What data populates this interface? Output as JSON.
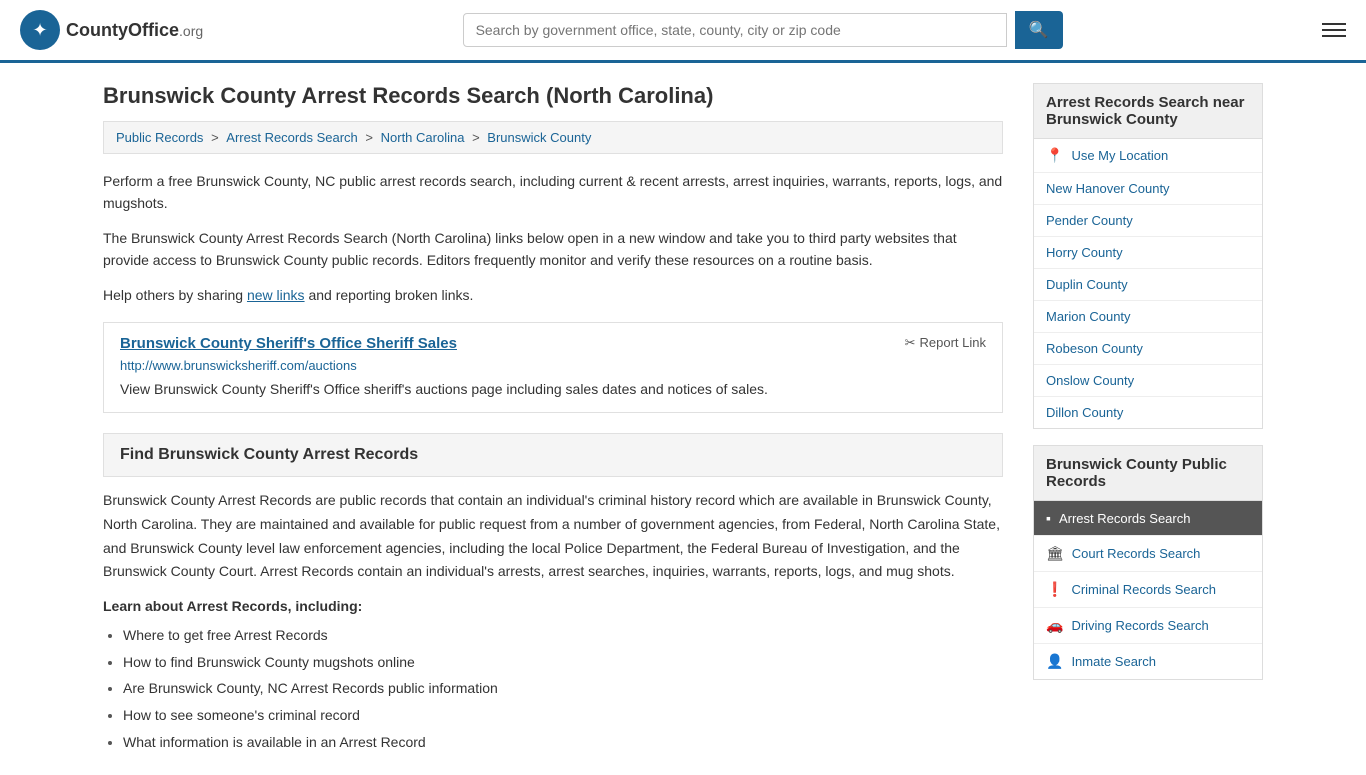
{
  "header": {
    "logo_symbol": "✦",
    "logo_name": "CountyOffice",
    "logo_suffix": ".org",
    "search_placeholder": "Search by government office, state, county, city or zip code",
    "search_value": ""
  },
  "page": {
    "title": "Brunswick County Arrest Records Search (North Carolina)"
  },
  "breadcrumb": {
    "items": [
      {
        "label": "Public Records",
        "href": "#"
      },
      {
        "label": "Arrest Records Search",
        "href": "#"
      },
      {
        "label": "North Carolina",
        "href": "#"
      },
      {
        "label": "Brunswick County",
        "href": "#"
      }
    ]
  },
  "description": {
    "para1": "Perform a free Brunswick County, NC public arrest records search, including current & recent arrests, arrest inquiries, warrants, reports, logs, and mugshots.",
    "para2": "The Brunswick County Arrest Records Search (North Carolina) links below open in a new window and take you to third party websites that provide access to Brunswick County public records. Editors frequently monitor and verify these resources on a routine basis.",
    "para3_prefix": "Help others by sharing ",
    "para3_link": "new links",
    "para3_suffix": " and reporting broken links."
  },
  "link_entry": {
    "title": "Brunswick County Sheriff's Office Sheriff Sales",
    "url": "http://www.brunswicksheriff.com/auctions",
    "report_label": "Report Link",
    "description": "View Brunswick County Sheriff's Office sheriff's auctions page including sales dates and notices of sales."
  },
  "find_section": {
    "title": "Find Brunswick County Arrest Records",
    "body": "Brunswick County Arrest Records are public records that contain an individual's criminal history record which are available in Brunswick County, North Carolina. They are maintained and available for public request from a number of government agencies, from Federal, North Carolina State, and Brunswick County level law enforcement agencies, including the local Police Department, the Federal Bureau of Investigation, and the Brunswick County Court. Arrest Records contain an individual's arrests, arrest searches, inquiries, warrants, reports, logs, and mug shots.",
    "learn_title": "Learn about Arrest Records, including:",
    "learn_items": [
      "Where to get free Arrest Records",
      "How to find Brunswick County mugshots online",
      "Are Brunswick County, NC Arrest Records public information",
      "How to see someone's criminal record",
      "What information is available in an Arrest Record"
    ]
  },
  "sidebar": {
    "nearby_title": "Arrest Records Search near Brunswick County",
    "use_location_label": "Use My Location",
    "nearby_links": [
      {
        "label": "New Hanover County",
        "href": "#"
      },
      {
        "label": "Pender County",
        "href": "#"
      },
      {
        "label": "Horry County",
        "href": "#"
      },
      {
        "label": "Duplin County",
        "href": "#"
      },
      {
        "label": "Marion County",
        "href": "#"
      },
      {
        "label": "Robeson County",
        "href": "#"
      },
      {
        "label": "Onslow County",
        "href": "#"
      },
      {
        "label": "Dillon County",
        "href": "#"
      }
    ],
    "public_records_title": "Brunswick County Public Records",
    "public_records_links": [
      {
        "label": "Arrest Records Search",
        "icon": "▪",
        "active": true
      },
      {
        "label": "Court Records Search",
        "icon": "🏛",
        "active": false
      },
      {
        "label": "Criminal Records Search",
        "icon": "❗",
        "active": false
      },
      {
        "label": "Driving Records Search",
        "icon": "🚗",
        "active": false
      },
      {
        "label": "Inmate Search",
        "icon": "👤",
        "active": false
      }
    ]
  }
}
